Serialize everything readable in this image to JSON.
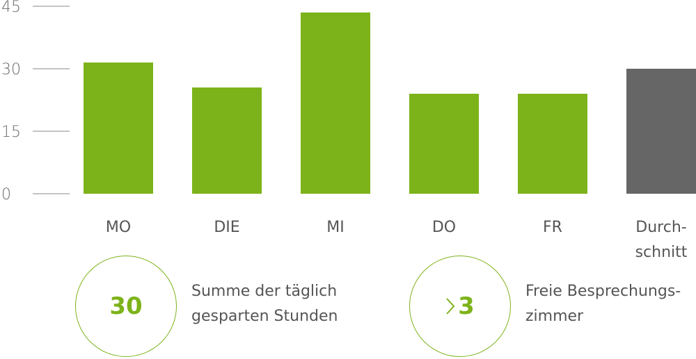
{
  "chart_data": {
    "type": "bar",
    "categories": [
      "MO",
      "DIE",
      "MI",
      "DO",
      "FR",
      "Durch-\nschnitt"
    ],
    "values": [
      31.5,
      25.5,
      43.5,
      24,
      24,
      30
    ],
    "yticks": [
      0,
      15,
      30,
      45
    ],
    "ylim": [
      0,
      45
    ],
    "grid": false,
    "colors": {
      "bar": "#7db31a",
      "highlight_bar": "#666666",
      "highlight_category": "Durch-\nschnitt"
    }
  },
  "stats": [
    {
      "value": "30",
      "label_line1": "Summe der täglich",
      "label_line2": "gesparten Stunden",
      "icon": null
    },
    {
      "value": "3",
      "label_line1": "Freie Besprechungs-",
      "label_line2": "zimmer",
      "icon": "greater-than-icon"
    }
  ],
  "colors": {
    "accent": "#7db31a",
    "text": "#555555"
  }
}
